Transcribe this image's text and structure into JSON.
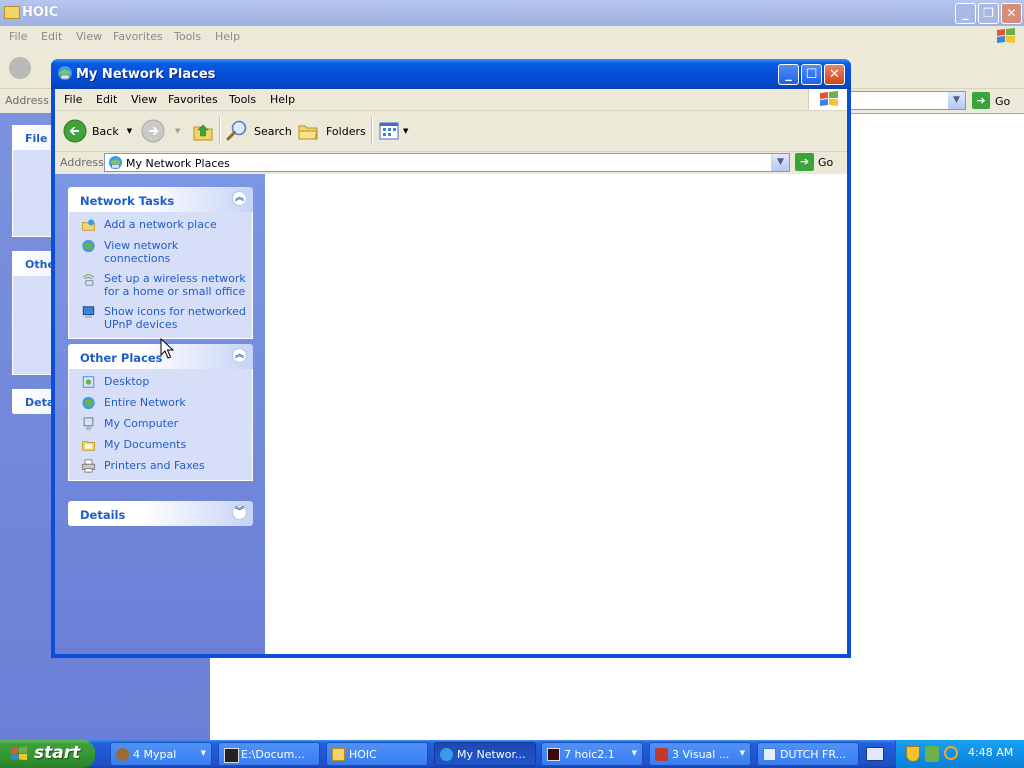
{
  "background_window": {
    "title": "HOIC",
    "menu": [
      "File",
      "Edit",
      "View",
      "Favorites",
      "Tools",
      "Help"
    ],
    "address_label": "Address",
    "go_label": "Go",
    "panel_titles": [
      "File a",
      "Othe",
      "Deta"
    ]
  },
  "window": {
    "title": "My Network Places",
    "menu": {
      "file": "File",
      "edit": "Edit",
      "view": "View",
      "favorites": "Favorites",
      "tools": "Tools",
      "help": "Help"
    },
    "toolbar": {
      "back": "Back",
      "search": "Search",
      "folders": "Folders"
    },
    "address": {
      "label": "Address",
      "value": "My Network Places",
      "go": "Go"
    }
  },
  "network_tasks": {
    "title": "Network Tasks",
    "items": [
      {
        "label": "Add a network place",
        "icon": "add-network-place-icon"
      },
      {
        "label": "View network connections",
        "icon": "network-connections-icon"
      },
      {
        "label": "Set up a wireless network for a home or small office",
        "icon": "wireless-network-icon"
      },
      {
        "label": "Show icons for networked UPnP devices",
        "icon": "upnp-devices-icon"
      }
    ]
  },
  "other_places": {
    "title": "Other Places",
    "items": [
      {
        "label": "Desktop",
        "icon": "desktop-icon"
      },
      {
        "label": "Entire Network",
        "icon": "globe-icon"
      },
      {
        "label": "My Computer",
        "icon": "my-computer-icon"
      },
      {
        "label": "My Documents",
        "icon": "my-documents-icon"
      },
      {
        "label": "Printers and Faxes",
        "icon": "printer-icon"
      }
    ]
  },
  "details": {
    "title": "Details"
  },
  "taskbar": {
    "start_label": "start",
    "buttons": [
      {
        "label": "4 Mypal",
        "active": false
      },
      {
        "label": "E:\\Docum...",
        "active": false
      },
      {
        "label": "HOIC",
        "active": false
      },
      {
        "label": "My Networ...",
        "active": true
      },
      {
        "label": "7 hoic2.1",
        "active": false
      },
      {
        "label": "3 Visual ...",
        "active": false
      },
      {
        "label": "DUTCH FR...",
        "active": false
      }
    ],
    "clock": "4:48 AM"
  },
  "colors": {
    "title_bar": "#0a5be0",
    "link_blue": "#215dc6",
    "task_pane": "#7b96e4",
    "taskbar": "#245edb",
    "start_green": "#3e9e3a"
  }
}
